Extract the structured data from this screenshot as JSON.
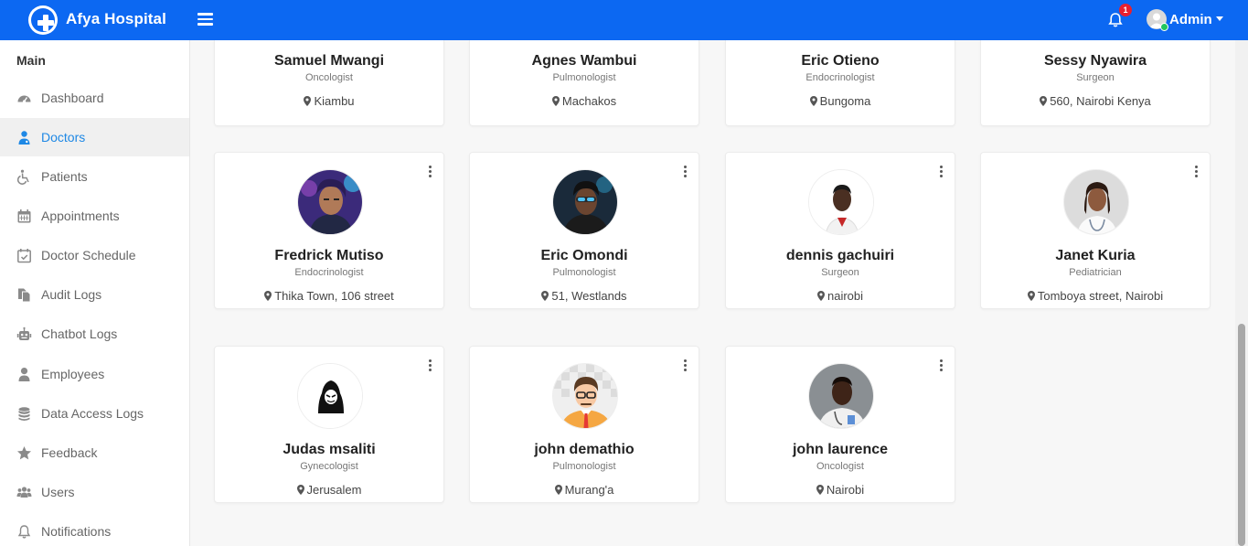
{
  "header": {
    "brand": "Afya Hospital",
    "notification_count": "1",
    "user_label": "Admin",
    "bg_color": "#0c68f2"
  },
  "sidebar": {
    "title": "Main",
    "items": [
      {
        "label": "Dashboard",
        "icon": "dashboard-icon"
      },
      {
        "label": "Doctors",
        "icon": "doctor-icon",
        "active": true
      },
      {
        "label": "Patients",
        "icon": "wheelchair-icon"
      },
      {
        "label": "Appointments",
        "icon": "calendar-icon"
      },
      {
        "label": "Doctor Schedule",
        "icon": "calendar-check-icon"
      },
      {
        "label": "Audit Logs",
        "icon": "documents-icon"
      },
      {
        "label": "Chatbot Logs",
        "icon": "robot-icon"
      },
      {
        "label": "Employees",
        "icon": "user-icon"
      },
      {
        "label": "Data Access Logs",
        "icon": "database-icon"
      },
      {
        "label": "Feedback",
        "icon": "star-icon"
      },
      {
        "label": "Users",
        "icon": "users-icon"
      },
      {
        "label": "Notifications",
        "icon": "bell-icon"
      }
    ],
    "active_color": "#1e88e5"
  },
  "doctors": [
    {
      "name": "Samuel Mwangi",
      "specialty": "Oncologist",
      "location": "Kiambu"
    },
    {
      "name": "Agnes Wambui",
      "specialty": "Pulmonologist",
      "location": "Machakos"
    },
    {
      "name": "Eric Otieno",
      "specialty": "Endocrinologist",
      "location": "Bungoma"
    },
    {
      "name": "Sessy Nyawira",
      "specialty": "Surgeon",
      "location": "560, Nairobi Kenya"
    },
    {
      "name": "Fredrick Mutiso",
      "specialty": "Endocrinologist",
      "location": "Thika Town, 106 street"
    },
    {
      "name": "Eric Omondi",
      "specialty": "Pulmonologist",
      "location": "51, Westlands"
    },
    {
      "name": "dennis gachuiri",
      "specialty": "Surgeon",
      "location": "nairobi"
    },
    {
      "name": "Janet Kuria",
      "specialty": "Pediatrician",
      "location": "Tomboya street, Nairobi"
    },
    {
      "name": "Judas msaliti",
      "specialty": "Gynecologist",
      "location": "Jerusalem"
    },
    {
      "name": "john demathio",
      "specialty": "Pulmonologist",
      "location": "Murang'a"
    },
    {
      "name": "john laurence",
      "specialty": "Oncologist",
      "location": "Nairobi"
    }
  ]
}
